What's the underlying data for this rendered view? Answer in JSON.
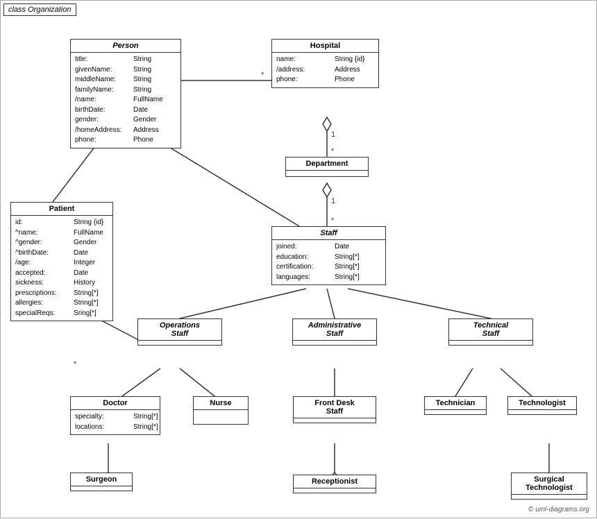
{
  "diagram": {
    "title": "class Organization",
    "copyright": "© uml-diagrams.org",
    "classes": {
      "person": {
        "name": "Person",
        "italic": true,
        "attrs": [
          {
            "name": "title:",
            "type": "String"
          },
          {
            "name": "givenName:",
            "type": "String"
          },
          {
            "name": "middleName:",
            "type": "String"
          },
          {
            "name": "familyName:",
            "type": "String"
          },
          {
            "name": "/name:",
            "type": "FullName"
          },
          {
            "name": "birthDate:",
            "type": "Date"
          },
          {
            "name": "gender:",
            "type": "Gender"
          },
          {
            "name": "/homeAddress:",
            "type": "Address"
          },
          {
            "name": "phone:",
            "type": "Phone"
          }
        ]
      },
      "hospital": {
        "name": "Hospital",
        "attrs": [
          {
            "name": "name:",
            "type": "String {id}"
          },
          {
            "name": "/address:",
            "type": "Address"
          },
          {
            "name": "phone:",
            "type": "Phone"
          }
        ]
      },
      "patient": {
        "name": "Patient",
        "attrs": [
          {
            "name": "id:",
            "type": "String {id}"
          },
          {
            "name": "^name:",
            "type": "FullName"
          },
          {
            "name": "^gender:",
            "type": "Gender"
          },
          {
            "name": "^birthDate:",
            "type": "Date"
          },
          {
            "name": "/age:",
            "type": "Integer"
          },
          {
            "name": "accepted:",
            "type": "Date"
          },
          {
            "name": "sickness:",
            "type": "History"
          },
          {
            "name": "prescriptions:",
            "type": "String[*]"
          },
          {
            "name": "allergies:",
            "type": "String[*]"
          },
          {
            "name": "specialReqs:",
            "type": "Sring[*]"
          }
        ]
      },
      "department": {
        "name": "Department",
        "attrs": []
      },
      "staff": {
        "name": "Staff",
        "italic": true,
        "attrs": [
          {
            "name": "joined:",
            "type": "Date"
          },
          {
            "name": "education:",
            "type": "String[*]"
          },
          {
            "name": "certification:",
            "type": "String[*]"
          },
          {
            "name": "languages:",
            "type": "String[*]"
          }
        ]
      },
      "operations_staff": {
        "name": "Operations\nStaff",
        "italic": true,
        "attrs": []
      },
      "administrative_staff": {
        "name": "Administrative\nStaff",
        "italic": true,
        "attrs": []
      },
      "technical_staff": {
        "name": "Technical\nStaff",
        "italic": true,
        "attrs": []
      },
      "doctor": {
        "name": "Doctor",
        "attrs": [
          {
            "name": "specialty:",
            "type": "String[*]"
          },
          {
            "name": "locations:",
            "type": "String[*]"
          }
        ]
      },
      "nurse": {
        "name": "Nurse",
        "attrs": []
      },
      "front_desk_staff": {
        "name": "Front Desk\nStaff",
        "attrs": []
      },
      "technician": {
        "name": "Technician",
        "attrs": []
      },
      "technologist": {
        "name": "Technologist",
        "attrs": []
      },
      "surgeon": {
        "name": "Surgeon",
        "attrs": []
      },
      "receptionist": {
        "name": "Receptionist",
        "attrs": []
      },
      "surgical_technologist": {
        "name": "Surgical\nTechnologist",
        "attrs": []
      }
    }
  }
}
